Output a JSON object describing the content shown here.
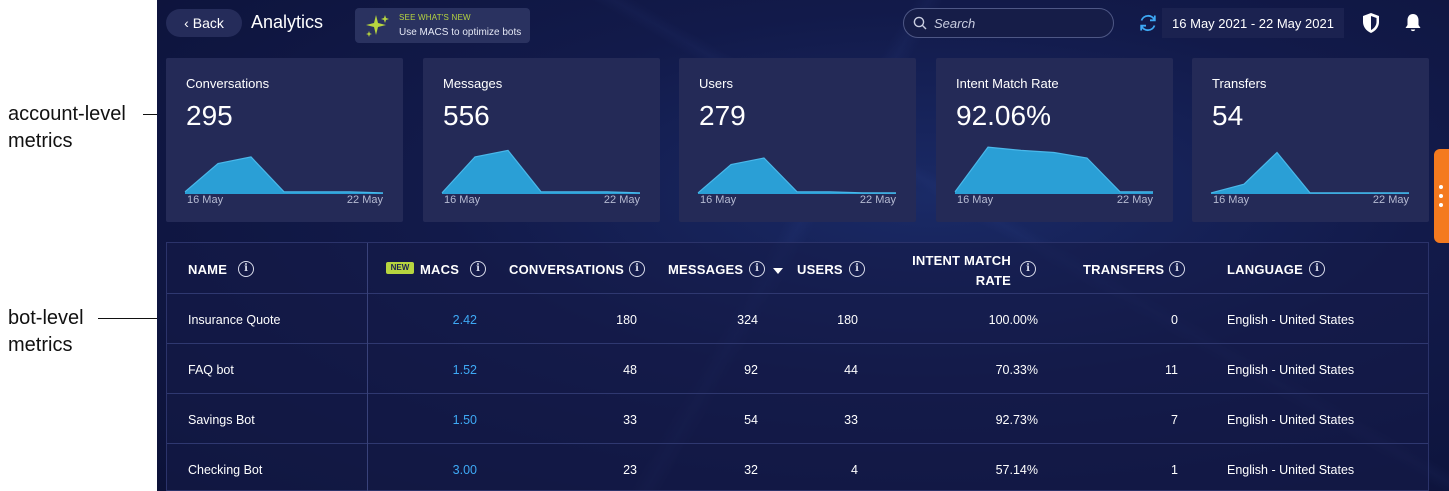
{
  "annotations": {
    "account_label_line1": "account-level",
    "account_label_line2": "metrics",
    "bot_label_line1": "bot-level",
    "bot_label_line2": "metrics"
  },
  "header": {
    "back_label": "Back",
    "title": "Analytics",
    "whats_new": {
      "kicker": "SEE WHAT'S NEW",
      "text": "Use MACS to optimize bots"
    },
    "search_placeholder": "Search",
    "date_range": "16 May 2021 - 22 May 2021",
    "icons": [
      "back-chevron-icon",
      "sparkle-icon",
      "search-icon",
      "refresh-icon",
      "shield-icon",
      "bell-icon"
    ]
  },
  "cards": [
    {
      "title": "Conversations",
      "value": "295",
      "start": "16 May",
      "end": "22 May",
      "trend": [
        2,
        28,
        34,
        2,
        2,
        2,
        1
      ]
    },
    {
      "title": "Messages",
      "value": "556",
      "start": "16 May",
      "end": "22 May",
      "trend": [
        1,
        34,
        40,
        2,
        2,
        2,
        1
      ]
    },
    {
      "title": "Users",
      "value": "279",
      "start": "16 May",
      "end": "22 May",
      "trend": [
        1,
        27,
        33,
        2,
        2,
        1,
        1
      ]
    },
    {
      "title": "Intent Match Rate",
      "value": "92.06%",
      "start": "16 May",
      "end": "22 May",
      "trend": [
        2,
        43,
        40,
        38,
        33,
        2,
        2
      ]
    },
    {
      "title": "Transfers",
      "value": "54",
      "start": "16 May",
      "end": "22 May",
      "trend": [
        1,
        9,
        38,
        1,
        1,
        1,
        1
      ]
    }
  ],
  "table": {
    "new_badge": "NEW",
    "headers": {
      "name": "NAME",
      "macs": "MACS",
      "conversations": "CONVERSATIONS",
      "messages": "MESSAGES",
      "users": "USERS",
      "intent_line1": "INTENT MATCH",
      "intent_line2": "RATE",
      "transfers": "TRANSFERS",
      "language": "LANGUAGE"
    },
    "rows": [
      {
        "name": "Insurance Quote",
        "macs": "2.42",
        "conversations": "180",
        "messages": "324",
        "users": "180",
        "intent_match_rate": "100.00%",
        "transfers": "0",
        "language": "English - United States"
      },
      {
        "name": "FAQ bot",
        "macs": "1.52",
        "conversations": "48",
        "messages": "92",
        "users": "44",
        "intent_match_rate": "70.33%",
        "transfers": "11",
        "language": "English - United States"
      },
      {
        "name": "Savings Bot",
        "macs": "1.50",
        "conversations": "33",
        "messages": "54",
        "users": "33",
        "intent_match_rate": "92.73%",
        "transfers": "7",
        "language": "English - United States"
      },
      {
        "name": "Checking Bot",
        "macs": "3.00",
        "conversations": "23",
        "messages": "32",
        "users": "4",
        "intent_match_rate": "57.14%",
        "transfers": "1",
        "language": "English - United States"
      }
    ]
  },
  "colors": {
    "accent_blue": "#3ea9f5",
    "chart_fill": "#2a9fd6",
    "new_badge": "#b7d53f",
    "side_tab": "#f47a1f"
  }
}
